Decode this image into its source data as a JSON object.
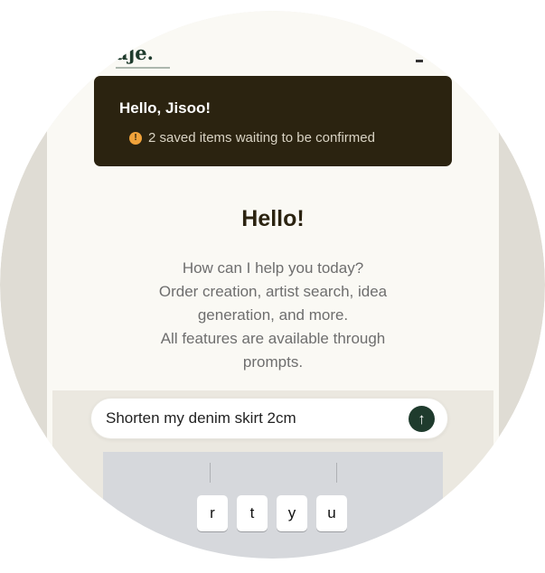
{
  "app": {
    "logo_text": "aje."
  },
  "banner": {
    "greeting": "Hello, Jisoo!",
    "notice": "2 saved items waiting to be confirmed",
    "notice_icon": "exclamation-circle-icon"
  },
  "main": {
    "heading": "Hello!",
    "intro_lines": [
      "How can I help you today?",
      "Order creation, artist search, idea",
      "generation, and more.",
      "All features are available through",
      "prompts."
    ]
  },
  "prompt": {
    "value": "Shorten my denim skirt 2cm",
    "send_icon": "arrow-up-icon"
  },
  "keyboard": {
    "keys": [
      "r",
      "t",
      "y",
      "u"
    ]
  },
  "colors": {
    "brand": "#1f3b2d",
    "banner_bg": "#2b2310",
    "warning": "#f0a23a"
  }
}
